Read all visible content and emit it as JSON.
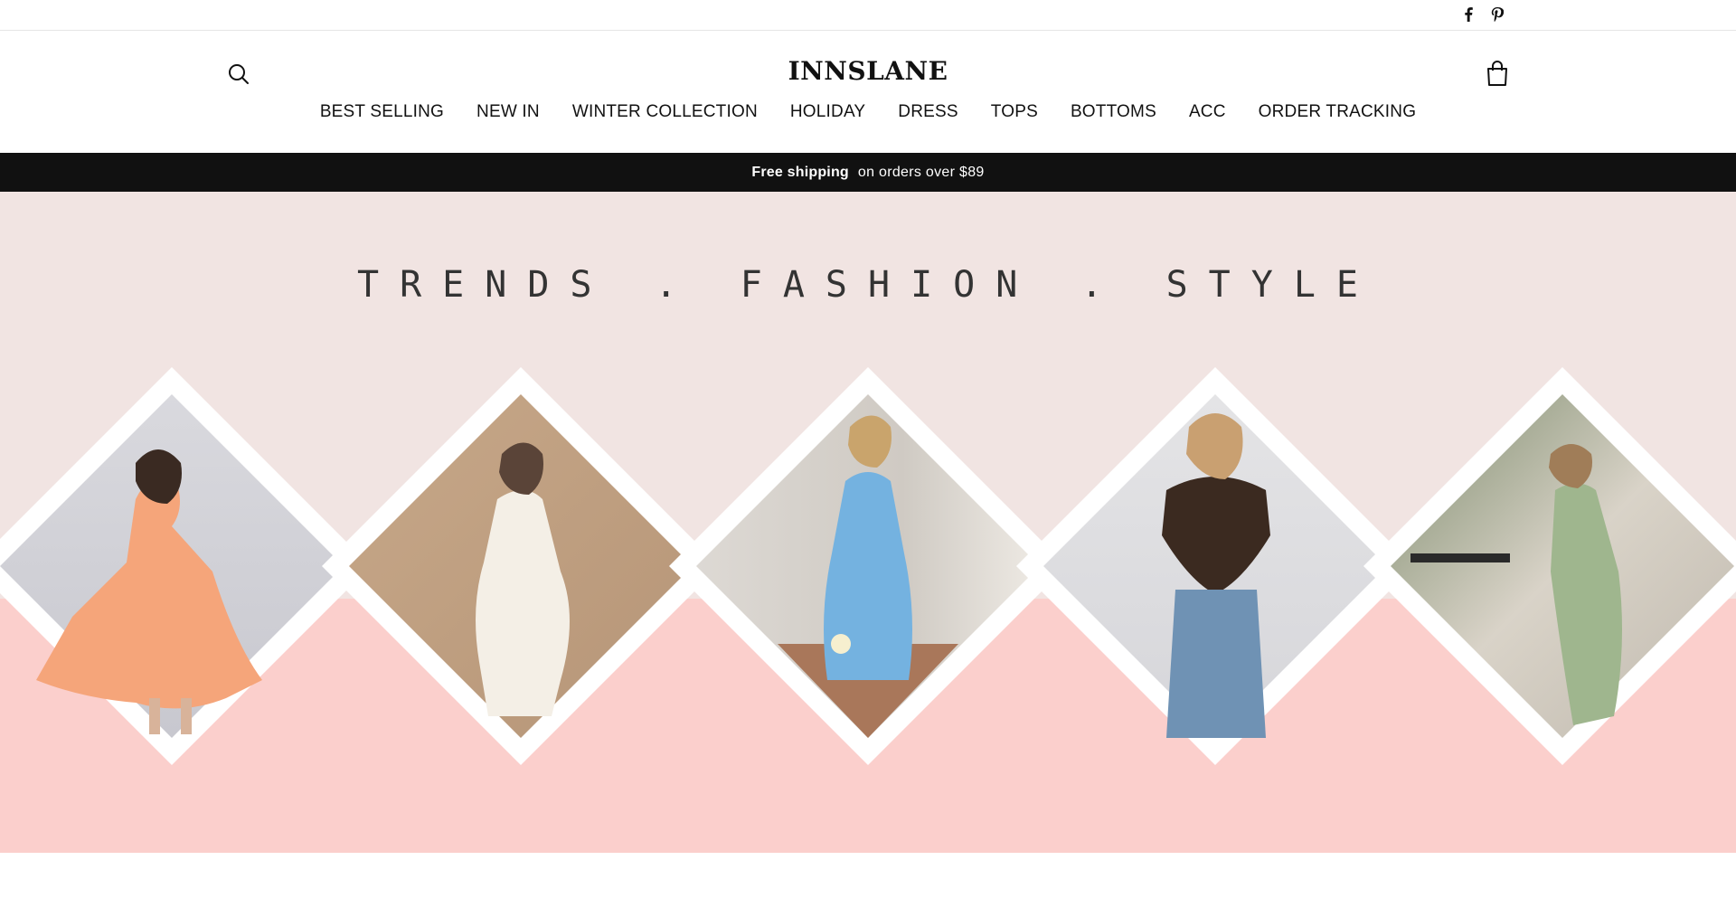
{
  "social": {
    "facebook_icon": "facebook-icon",
    "pinterest_icon": "pinterest-icon"
  },
  "header": {
    "logo": "INNSLANE",
    "search_icon": "search-icon",
    "cart_icon": "cart-icon"
  },
  "nav": {
    "items": [
      {
        "label": "BEST SELLING"
      },
      {
        "label": "NEW IN"
      },
      {
        "label": "WINTER COLLECTION"
      },
      {
        "label": "HOLIDAY"
      },
      {
        "label": "DRESS"
      },
      {
        "label": "TOPS"
      },
      {
        "label": "BOTTOMS"
      },
      {
        "label": "ACC"
      },
      {
        "label": "ORDER TRACKING"
      }
    ]
  },
  "announcement": {
    "strong": "Free shipping",
    "rest": "on orders over $89"
  },
  "hero": {
    "title": "TRENDS . FASHION . STYLE",
    "colors": {
      "top_background": "#f1e4e2",
      "bottom_background": "#fbcfcc",
      "diamond_border": "#ffffff"
    },
    "products": [
      {
        "name": "peach-mini-dress-photo"
      },
      {
        "name": "white-draped-dress-photo"
      },
      {
        "name": "blue-mini-dress-photo"
      },
      {
        "name": "brown-halter-top-jeans-photo"
      },
      {
        "name": "green-maxi-dress-photo"
      }
    ]
  },
  "colors": {
    "announcement_bg": "#111111",
    "text": "#111111"
  }
}
